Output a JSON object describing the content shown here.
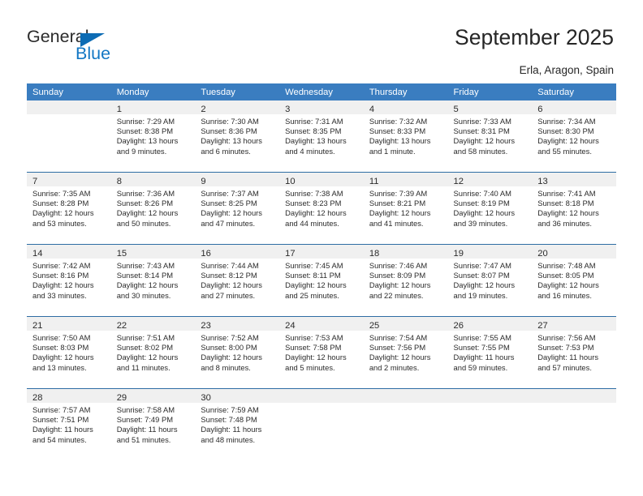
{
  "brand": {
    "name_part1": "General",
    "name_part2": "Blue",
    "triangle_color": "#0d6cb4",
    "blue_color": "#1277c4"
  },
  "header": {
    "title": "September 2025",
    "location": "Erla, Aragon, Spain"
  },
  "theme": {
    "header_row_bg": "#3a7dc0",
    "week_separator": "#2e6da4",
    "daynum_strip_bg": "#f0f0f0",
    "text": "#2b2b2b"
  },
  "weekday_headers": [
    "Sunday",
    "Monday",
    "Tuesday",
    "Wednesday",
    "Thursday",
    "Friday",
    "Saturday"
  ],
  "weeks": [
    [
      {
        "day": "",
        "sunrise": "",
        "sunset": "",
        "daylight_line1": "",
        "daylight_line2": "",
        "empty": true
      },
      {
        "day": "1",
        "sunrise": "Sunrise: 7:29 AM",
        "sunset": "Sunset: 8:38 PM",
        "daylight_line1": "Daylight: 13 hours",
        "daylight_line2": "and 9 minutes."
      },
      {
        "day": "2",
        "sunrise": "Sunrise: 7:30 AM",
        "sunset": "Sunset: 8:36 PM",
        "daylight_line1": "Daylight: 13 hours",
        "daylight_line2": "and 6 minutes."
      },
      {
        "day": "3",
        "sunrise": "Sunrise: 7:31 AM",
        "sunset": "Sunset: 8:35 PM",
        "daylight_line1": "Daylight: 13 hours",
        "daylight_line2": "and 4 minutes."
      },
      {
        "day": "4",
        "sunrise": "Sunrise: 7:32 AM",
        "sunset": "Sunset: 8:33 PM",
        "daylight_line1": "Daylight: 13 hours",
        "daylight_line2": "and 1 minute."
      },
      {
        "day": "5",
        "sunrise": "Sunrise: 7:33 AM",
        "sunset": "Sunset: 8:31 PM",
        "daylight_line1": "Daylight: 12 hours",
        "daylight_line2": "and 58 minutes."
      },
      {
        "day": "6",
        "sunrise": "Sunrise: 7:34 AM",
        "sunset": "Sunset: 8:30 PM",
        "daylight_line1": "Daylight: 12 hours",
        "daylight_line2": "and 55 minutes."
      }
    ],
    [
      {
        "day": "7",
        "sunrise": "Sunrise: 7:35 AM",
        "sunset": "Sunset: 8:28 PM",
        "daylight_line1": "Daylight: 12 hours",
        "daylight_line2": "and 53 minutes."
      },
      {
        "day": "8",
        "sunrise": "Sunrise: 7:36 AM",
        "sunset": "Sunset: 8:26 PM",
        "daylight_line1": "Daylight: 12 hours",
        "daylight_line2": "and 50 minutes."
      },
      {
        "day": "9",
        "sunrise": "Sunrise: 7:37 AM",
        "sunset": "Sunset: 8:25 PM",
        "daylight_line1": "Daylight: 12 hours",
        "daylight_line2": "and 47 minutes."
      },
      {
        "day": "10",
        "sunrise": "Sunrise: 7:38 AM",
        "sunset": "Sunset: 8:23 PM",
        "daylight_line1": "Daylight: 12 hours",
        "daylight_line2": "and 44 minutes."
      },
      {
        "day": "11",
        "sunrise": "Sunrise: 7:39 AM",
        "sunset": "Sunset: 8:21 PM",
        "daylight_line1": "Daylight: 12 hours",
        "daylight_line2": "and 41 minutes."
      },
      {
        "day": "12",
        "sunrise": "Sunrise: 7:40 AM",
        "sunset": "Sunset: 8:19 PM",
        "daylight_line1": "Daylight: 12 hours",
        "daylight_line2": "and 39 minutes."
      },
      {
        "day": "13",
        "sunrise": "Sunrise: 7:41 AM",
        "sunset": "Sunset: 8:18 PM",
        "daylight_line1": "Daylight: 12 hours",
        "daylight_line2": "and 36 minutes."
      }
    ],
    [
      {
        "day": "14",
        "sunrise": "Sunrise: 7:42 AM",
        "sunset": "Sunset: 8:16 PM",
        "daylight_line1": "Daylight: 12 hours",
        "daylight_line2": "and 33 minutes."
      },
      {
        "day": "15",
        "sunrise": "Sunrise: 7:43 AM",
        "sunset": "Sunset: 8:14 PM",
        "daylight_line1": "Daylight: 12 hours",
        "daylight_line2": "and 30 minutes."
      },
      {
        "day": "16",
        "sunrise": "Sunrise: 7:44 AM",
        "sunset": "Sunset: 8:12 PM",
        "daylight_line1": "Daylight: 12 hours",
        "daylight_line2": "and 27 minutes."
      },
      {
        "day": "17",
        "sunrise": "Sunrise: 7:45 AM",
        "sunset": "Sunset: 8:11 PM",
        "daylight_line1": "Daylight: 12 hours",
        "daylight_line2": "and 25 minutes."
      },
      {
        "day": "18",
        "sunrise": "Sunrise: 7:46 AM",
        "sunset": "Sunset: 8:09 PM",
        "daylight_line1": "Daylight: 12 hours",
        "daylight_line2": "and 22 minutes."
      },
      {
        "day": "19",
        "sunrise": "Sunrise: 7:47 AM",
        "sunset": "Sunset: 8:07 PM",
        "daylight_line1": "Daylight: 12 hours",
        "daylight_line2": "and 19 minutes."
      },
      {
        "day": "20",
        "sunrise": "Sunrise: 7:48 AM",
        "sunset": "Sunset: 8:05 PM",
        "daylight_line1": "Daylight: 12 hours",
        "daylight_line2": "and 16 minutes."
      }
    ],
    [
      {
        "day": "21",
        "sunrise": "Sunrise: 7:50 AM",
        "sunset": "Sunset: 8:03 PM",
        "daylight_line1": "Daylight: 12 hours",
        "daylight_line2": "and 13 minutes."
      },
      {
        "day": "22",
        "sunrise": "Sunrise: 7:51 AM",
        "sunset": "Sunset: 8:02 PM",
        "daylight_line1": "Daylight: 12 hours",
        "daylight_line2": "and 11 minutes."
      },
      {
        "day": "23",
        "sunrise": "Sunrise: 7:52 AM",
        "sunset": "Sunset: 8:00 PM",
        "daylight_line1": "Daylight: 12 hours",
        "daylight_line2": "and 8 minutes."
      },
      {
        "day": "24",
        "sunrise": "Sunrise: 7:53 AM",
        "sunset": "Sunset: 7:58 PM",
        "daylight_line1": "Daylight: 12 hours",
        "daylight_line2": "and 5 minutes."
      },
      {
        "day": "25",
        "sunrise": "Sunrise: 7:54 AM",
        "sunset": "Sunset: 7:56 PM",
        "daylight_line1": "Daylight: 12 hours",
        "daylight_line2": "and 2 minutes."
      },
      {
        "day": "26",
        "sunrise": "Sunrise: 7:55 AM",
        "sunset": "Sunset: 7:55 PM",
        "daylight_line1": "Daylight: 11 hours",
        "daylight_line2": "and 59 minutes."
      },
      {
        "day": "27",
        "sunrise": "Sunrise: 7:56 AM",
        "sunset": "Sunset: 7:53 PM",
        "daylight_line1": "Daylight: 11 hours",
        "daylight_line2": "and 57 minutes."
      }
    ],
    [
      {
        "day": "28",
        "sunrise": "Sunrise: 7:57 AM",
        "sunset": "Sunset: 7:51 PM",
        "daylight_line1": "Daylight: 11 hours",
        "daylight_line2": "and 54 minutes."
      },
      {
        "day": "29",
        "sunrise": "Sunrise: 7:58 AM",
        "sunset": "Sunset: 7:49 PM",
        "daylight_line1": "Daylight: 11 hours",
        "daylight_line2": "and 51 minutes."
      },
      {
        "day": "30",
        "sunrise": "Sunrise: 7:59 AM",
        "sunset": "Sunset: 7:48 PM",
        "daylight_line1": "Daylight: 11 hours",
        "daylight_line2": "and 48 minutes."
      },
      {
        "day": "",
        "sunrise": "",
        "sunset": "",
        "daylight_line1": "",
        "daylight_line2": "",
        "empty": true
      },
      {
        "day": "",
        "sunrise": "",
        "sunset": "",
        "daylight_line1": "",
        "daylight_line2": "",
        "empty": true
      },
      {
        "day": "",
        "sunrise": "",
        "sunset": "",
        "daylight_line1": "",
        "daylight_line2": "",
        "empty": true
      },
      {
        "day": "",
        "sunrise": "",
        "sunset": "",
        "daylight_line1": "",
        "daylight_line2": "",
        "empty": true
      }
    ]
  ]
}
